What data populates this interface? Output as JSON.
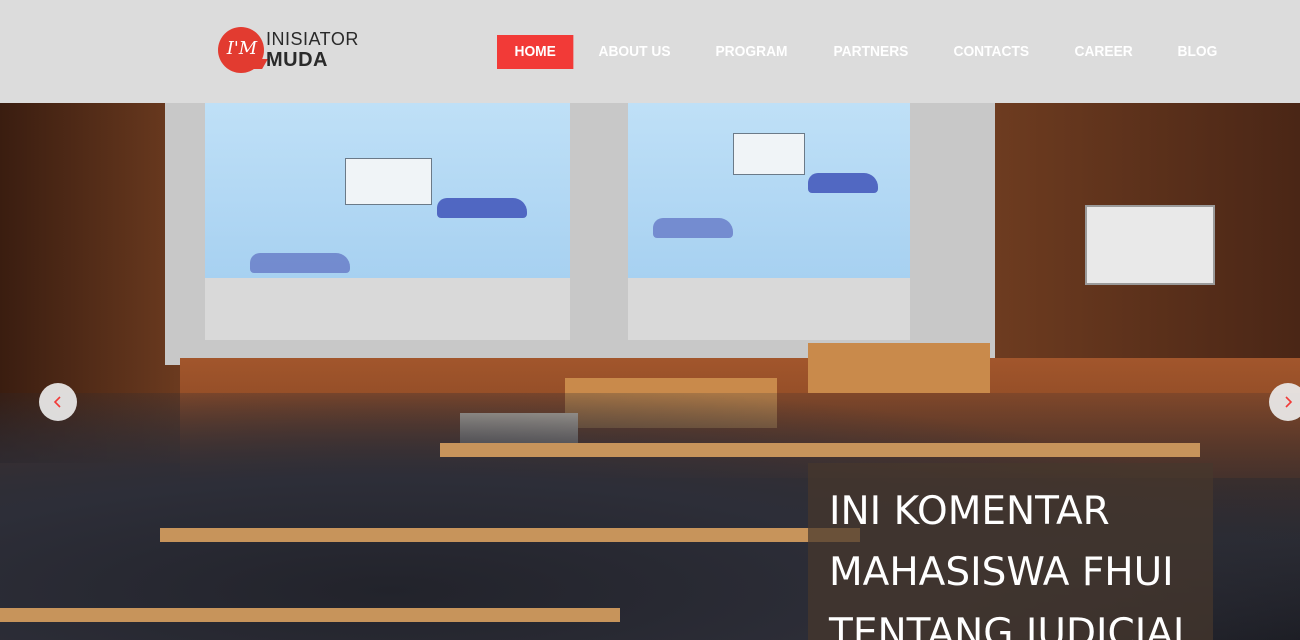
{
  "brand": {
    "mark": "I'M",
    "line1": "INISIATOR",
    "line2": "MUDA",
    "accent_color": "#f23a37"
  },
  "nav": {
    "items": [
      {
        "label": "HOME",
        "active": true
      },
      {
        "label": "ABOUT US",
        "active": false
      },
      {
        "label": "PROGRAM",
        "active": false
      },
      {
        "label": "PARTNERS",
        "active": false
      },
      {
        "label": "CONTACTS",
        "active": false
      },
      {
        "label": "CAREER",
        "active": false
      },
      {
        "label": "BLOG",
        "active": false
      }
    ]
  },
  "slider": {
    "image_subject": "lecture-hall",
    "caption": "INI KOMENTAR MAHASISWA FHUI TENTANG JUDICIAL",
    "prev_icon": "chevron-left-icon",
    "next_icon": "chevron-right-icon"
  }
}
